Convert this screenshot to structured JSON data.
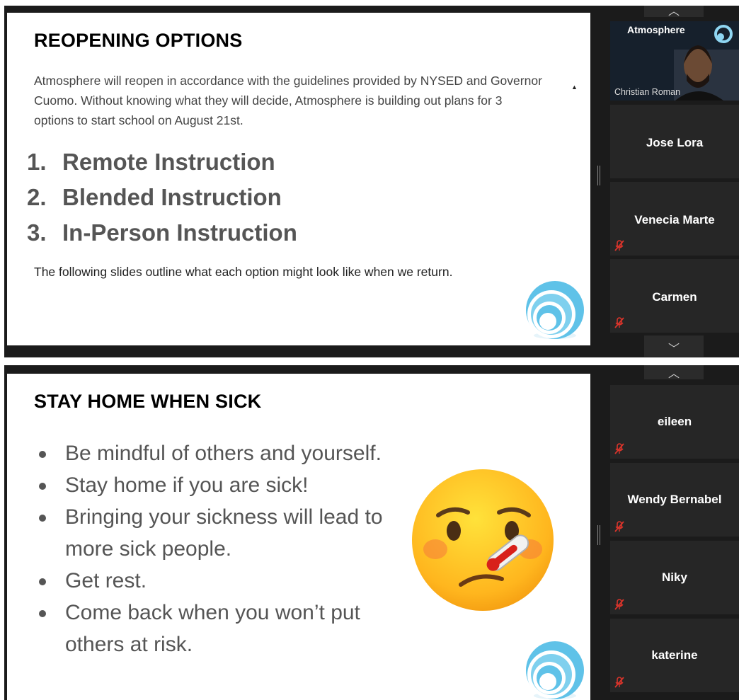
{
  "top_slide": {
    "title": "REOPENING OPTIONS",
    "intro": "Atmosphere will reopen in accordance with the guidelines provided by NYSED and Governor Cuomo. Without knowing what they will decide, Atmosphere is building out plans for 3 options to start school on August 21st.",
    "options": [
      {
        "num": "1.",
        "label": "Remote Instruction"
      },
      {
        "num": "2.",
        "label": "Blended Instruction"
      },
      {
        "num": "3.",
        "label": "In-Person Instruction"
      }
    ],
    "outro": "The following slides outline what each option might look like when we return."
  },
  "bottom_slide": {
    "title": "STAY HOME WHEN SICK",
    "bullets": [
      "Be mindful of others and yourself.",
      "Stay home if you are sick!",
      "Bringing your sickness will lead to more sick people.",
      "Get rest.",
      "Come back when you won’t put others at risk."
    ]
  },
  "top_gallery": {
    "video_tile": {
      "brand": "Atmosphere",
      "caption": "Christian Roman"
    },
    "participants": [
      "Jose Lora",
      "Venecia Marte",
      "Carmen"
    ],
    "nav_up": "︿",
    "nav_down": "﹀"
  },
  "bottom_gallery": {
    "participants": [
      "eileen",
      "Wendy Bernabel",
      "Niky",
      "katerine"
    ],
    "nav_up": "︿"
  },
  "colors": {
    "meeting_background": "#1b1b1b",
    "tile_background": "#262626",
    "mute_icon": "#d9342b",
    "logo_blue": "#5fc2e8"
  }
}
